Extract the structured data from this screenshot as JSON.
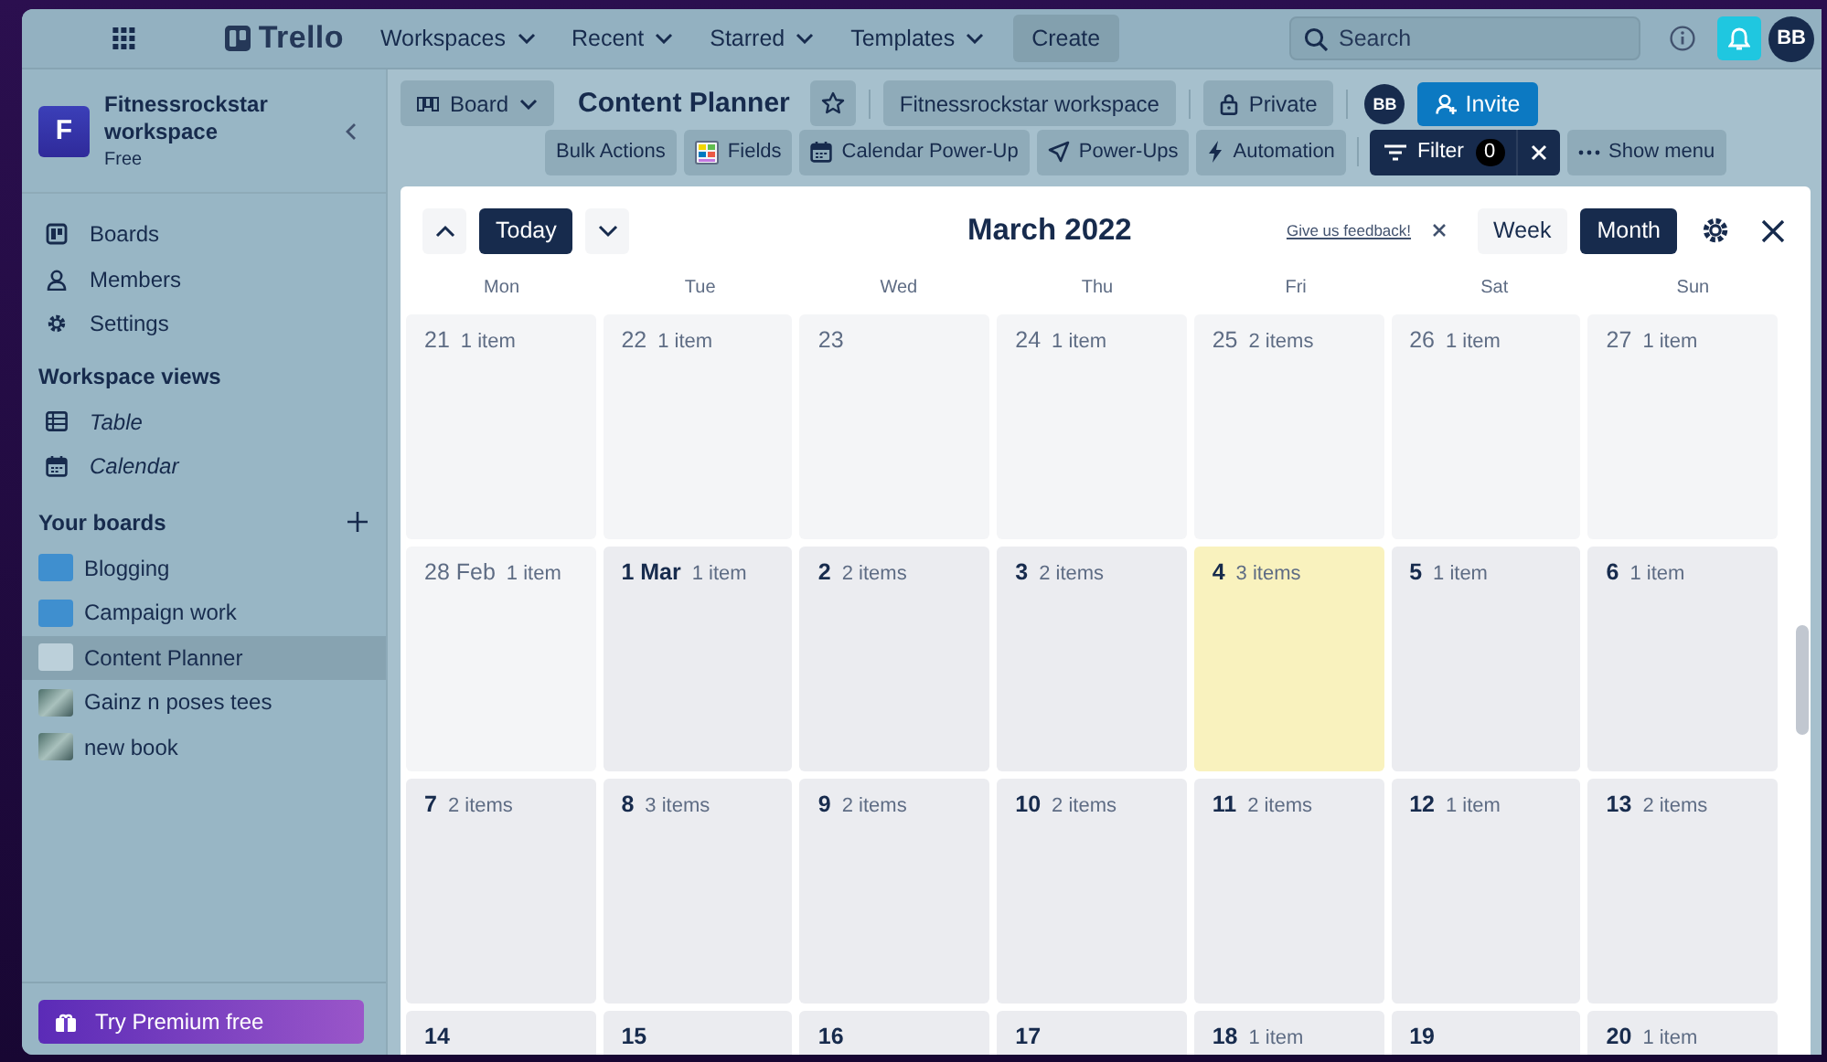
{
  "topbar": {
    "logo": "Trello",
    "menus": [
      "Workspaces",
      "Recent",
      "Starred",
      "Templates"
    ],
    "create": "Create",
    "search": {
      "placeholder": "Search"
    },
    "avatar": "BB"
  },
  "sidebar": {
    "workspace": {
      "initial": "F",
      "name": "Fitnessrockstar workspace",
      "plan": "Free"
    },
    "nav": [
      {
        "label": "Boards"
      },
      {
        "label": "Members"
      },
      {
        "label": "Settings"
      }
    ],
    "views_title": "Workspace views",
    "views": [
      {
        "label": "Table"
      },
      {
        "label": "Calendar"
      }
    ],
    "boards_title": "Your boards",
    "boards": [
      {
        "label": "Blogging",
        "kind": "color",
        "color": "#3f8fcf",
        "selected": false
      },
      {
        "label": "Campaign work",
        "kind": "color",
        "color": "#3f8fcf",
        "selected": false
      },
      {
        "label": "Content Planner",
        "kind": "color",
        "color": "#bcd0da",
        "selected": true
      },
      {
        "label": "Gainz n poses tees",
        "kind": "photo",
        "selected": false
      },
      {
        "label": "new book",
        "kind": "photo",
        "selected": false
      }
    ],
    "premium": "Try Premium free"
  },
  "board_header": {
    "view": "Board",
    "title": "Content Planner",
    "workspace": "Fitnessrockstar workspace",
    "visibility": "Private",
    "member": "BB",
    "invite": "Invite",
    "tools": [
      "Bulk Actions",
      "Fields",
      "Calendar Power-Up",
      "Power-Ups",
      "Automation"
    ],
    "filter": {
      "label": "Filter",
      "count": "0"
    },
    "menu": "Show menu"
  },
  "calendar": {
    "title": "March 2022",
    "today": "Today",
    "feedback": "Give us feedback!",
    "modes": [
      {
        "label": "Week",
        "selected": false
      },
      {
        "label": "Month",
        "selected": true
      }
    ],
    "weekdays": [
      "Mon",
      "Tue",
      "Wed",
      "Thu",
      "Fri",
      "Sat",
      "Sun"
    ],
    "weeks": [
      [
        {
          "day": "21",
          "count": "1 item",
          "kind": "outside"
        },
        {
          "day": "22",
          "count": "1 item",
          "kind": "outside"
        },
        {
          "day": "23",
          "kind": "outside"
        },
        {
          "day": "24",
          "count": "1 item",
          "kind": "outside"
        },
        {
          "day": "25",
          "count": "2 items",
          "kind": "outside"
        },
        {
          "day": "26",
          "count": "1 item",
          "kind": "outside"
        },
        {
          "day": "27",
          "count": "1 item",
          "kind": "outside"
        }
      ],
      [
        {
          "day": "28 Feb",
          "count": "1 item",
          "kind": "outside"
        },
        {
          "day": "1 Mar",
          "count": "1 item",
          "kind": "current"
        },
        {
          "day": "2",
          "count": "2 items",
          "kind": "current"
        },
        {
          "day": "3",
          "count": "2 items",
          "kind": "current"
        },
        {
          "day": "4",
          "count": "3 items",
          "kind": "today"
        },
        {
          "day": "5",
          "count": "1 item",
          "kind": "current"
        },
        {
          "day": "6",
          "count": "1 item",
          "kind": "current"
        }
      ],
      [
        {
          "day": "7",
          "count": "2 items",
          "kind": "current"
        },
        {
          "day": "8",
          "count": "3 items",
          "kind": "current"
        },
        {
          "day": "9",
          "count": "2 items",
          "kind": "current"
        },
        {
          "day": "10",
          "count": "2 items",
          "kind": "current"
        },
        {
          "day": "11",
          "count": "2 items",
          "kind": "current"
        },
        {
          "day": "12",
          "count": "1 item",
          "kind": "current"
        },
        {
          "day": "13",
          "count": "2 items",
          "kind": "current"
        }
      ],
      [
        {
          "day": "14",
          "kind": "current"
        },
        {
          "day": "15",
          "kind": "current"
        },
        {
          "day": "16",
          "kind": "current"
        },
        {
          "day": "17",
          "kind": "current"
        },
        {
          "day": "18",
          "count": "1 item",
          "kind": "current"
        },
        {
          "day": "19",
          "kind": "current"
        },
        {
          "day": "20",
          "count": "1 item",
          "kind": "current"
        }
      ]
    ]
  }
}
